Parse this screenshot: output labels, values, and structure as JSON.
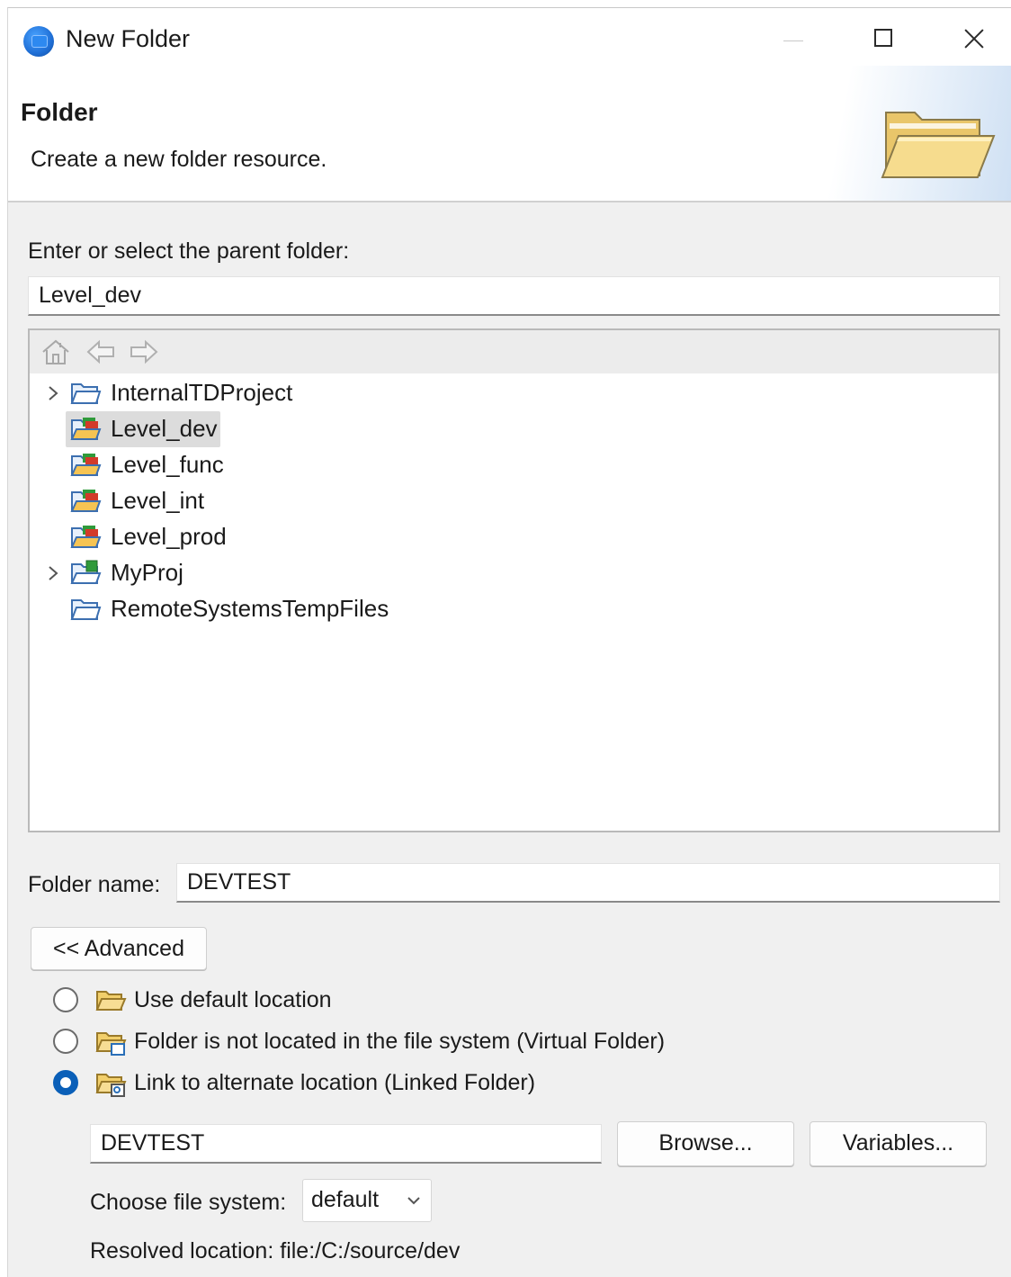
{
  "window": {
    "title": "New Folder",
    "icon": "eclipse-app-icon"
  },
  "header": {
    "title": "Folder",
    "description": "Create a new folder resource.",
    "icon": "open-folder-icon"
  },
  "parent": {
    "label": "Enter or select the parent folder:",
    "value": "Level_dev"
  },
  "tree": {
    "toolbar": [
      "home-icon",
      "back-arrow-icon",
      "forward-arrow-icon"
    ],
    "items": [
      {
        "label": "InternalTDProject",
        "expandable": true,
        "icon": "project-folder-icon",
        "selected": false
      },
      {
        "label": "Level_dev",
        "expandable": false,
        "icon": "talend-project-icon",
        "selected": true
      },
      {
        "label": "Level_func",
        "expandable": false,
        "icon": "talend-project-icon",
        "selected": false
      },
      {
        "label": "Level_int",
        "expandable": false,
        "icon": "talend-project-icon",
        "selected": false
      },
      {
        "label": "Level_prod",
        "expandable": false,
        "icon": "talend-project-icon",
        "selected": false
      },
      {
        "label": "MyProj",
        "expandable": true,
        "icon": "java-project-icon",
        "selected": false
      },
      {
        "label": "RemoteSystemsTempFiles",
        "expandable": false,
        "icon": "project-folder-icon",
        "selected": false
      }
    ]
  },
  "folder_name": {
    "label": "Folder name:",
    "value": "DEVTEST"
  },
  "advanced_button": "<< Advanced",
  "location_options": [
    {
      "label": "Use default location",
      "checked": false,
      "icon": "folder-icon"
    },
    {
      "label": "Folder is not located in the file system (Virtual Folder)",
      "checked": false,
      "icon": "virtual-folder-icon"
    },
    {
      "label": "Link to alternate location (Linked Folder)",
      "checked": true,
      "icon": "linked-folder-icon"
    }
  ],
  "linked": {
    "path_value": "DEVTEST",
    "browse_label": "Browse...",
    "variables_label": "Variables..."
  },
  "file_system": {
    "label": "Choose file system:",
    "selected": "default"
  },
  "resolved": {
    "label": "Resolved location:",
    "value": "file:/C:/source/dev"
  },
  "colors": {
    "accent": "#0a5fb8",
    "selection": "#dcdcdc",
    "folder": "#f2cf6b"
  }
}
